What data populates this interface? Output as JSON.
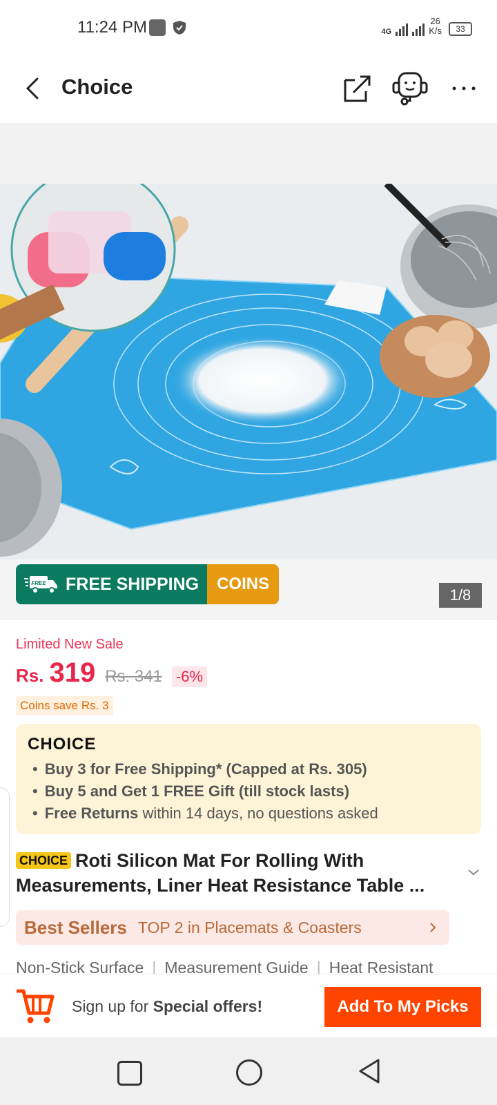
{
  "status_bar": {
    "time": "11:24 PM",
    "network": "4G",
    "speed_value": "26",
    "speed_unit": "K/s",
    "battery": "33"
  },
  "header": {
    "title": "Choice",
    "icons": [
      "back-icon",
      "share-icon",
      "customer-support-icon",
      "more-icon"
    ]
  },
  "gallery": {
    "counter": "1/8",
    "badge_free_label": "FREE",
    "badge_free": "FREE SHIPPING",
    "badge_coins": "COINS"
  },
  "price": {
    "sale_label": "Limited New Sale",
    "currency": "Rs.",
    "current": "319",
    "original": "Rs. 341",
    "discount": "-6%",
    "coins_save": "Coins save Rs. 3"
  },
  "choice_box": {
    "logo": "CHOICE",
    "benefits": [
      {
        "bold": "Buy 3 for  Free Shipping* (Capped at Rs. 305)",
        "rest": ""
      },
      {
        "bold": "Buy 5 and Get 1 FREE Gift (till stock lasts)",
        "rest": ""
      },
      {
        "bold": "Free Returns",
        "rest": " within 14 days, no questions asked"
      }
    ]
  },
  "product": {
    "tag": "CHOICE",
    "title": "Roti Silicon Mat For Rolling With Measurements, Liner Heat Resistance Table ..."
  },
  "best_sellers": {
    "label": "Best Sellers",
    "text": "TOP 2 in Placemats & Coasters"
  },
  "features": [
    "Non-Stick Surface",
    "Measurement Guide",
    "Heat Resistant"
  ],
  "bottom_bar": {
    "signup_prefix": "Sign up for ",
    "signup_bold": "Special offers!",
    "add_button": "Add To My Picks"
  },
  "colors": {
    "price_red": "#e8254a",
    "cta_orange": "#ff4400",
    "shipping_green": "#0b7a5e",
    "coins_orange": "#e69a11",
    "choice_bg": "#fdf3d6"
  }
}
